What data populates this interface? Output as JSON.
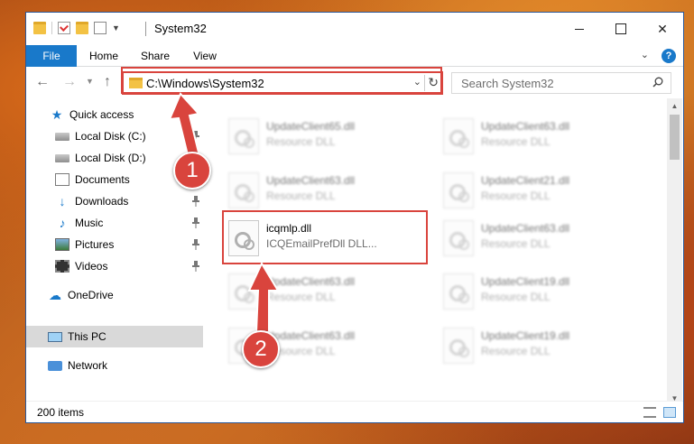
{
  "window": {
    "title": "System32"
  },
  "ribbon": {
    "tabs": [
      "File",
      "Home",
      "Share",
      "View"
    ]
  },
  "nav": {
    "address": "C:\\Windows\\System32",
    "search_placeholder": "Search System32"
  },
  "sidebar": {
    "items": [
      {
        "label": "Quick access",
        "icon": "star-icon",
        "pinned": false
      },
      {
        "label": "Local Disk (C:)",
        "icon": "drive-icon",
        "pinned": true
      },
      {
        "label": "Local Disk (D:)",
        "icon": "drive-icon",
        "pinned": true
      },
      {
        "label": "Documents",
        "icon": "documents-icon",
        "pinned": true
      },
      {
        "label": "Downloads",
        "icon": "download-icon",
        "pinned": true
      },
      {
        "label": "Music",
        "icon": "music-icon",
        "pinned": true
      },
      {
        "label": "Pictures",
        "icon": "pictures-icon",
        "pinned": true
      },
      {
        "label": "Videos",
        "icon": "videos-icon",
        "pinned": true
      },
      {
        "label": "OneDrive",
        "icon": "onedrive-icon",
        "pinned": false
      },
      {
        "label": "This PC",
        "icon": "this-pc-icon",
        "pinned": false,
        "selected": true
      },
      {
        "label": "Network",
        "icon": "network-icon",
        "pinned": false
      }
    ]
  },
  "files": [
    {
      "name": "UpdateClient65.dll",
      "desc": "Resource DLL"
    },
    {
      "name": "UpdateClient63.dll",
      "desc": "Resource DLL"
    },
    {
      "name": "UpdateClient63.dll",
      "desc": "Resource DLL"
    },
    {
      "name": "UpdateClient21.dll",
      "desc": "Resource DLL"
    },
    {
      "name": "icqmlp.dll",
      "desc": "ICQEmailPrefDll DLL..."
    },
    {
      "name": "UpdateClient63.dll",
      "desc": "Resource DLL"
    },
    {
      "name": "UpdateClient63.dll",
      "desc": "Resource DLL"
    },
    {
      "name": "UpdateClient19.dll",
      "desc": "Resource DLL"
    },
    {
      "name": "UpdateClient63.dll",
      "desc": "Resource DLL"
    },
    {
      "name": "UpdateClient19.dll",
      "desc": "Resource DLL"
    }
  ],
  "status": {
    "item_count": "200 items"
  },
  "annotations": {
    "marker1": "1",
    "marker2": "2"
  },
  "colors": {
    "accent": "#1979ca",
    "annotation": "#d9443d"
  }
}
